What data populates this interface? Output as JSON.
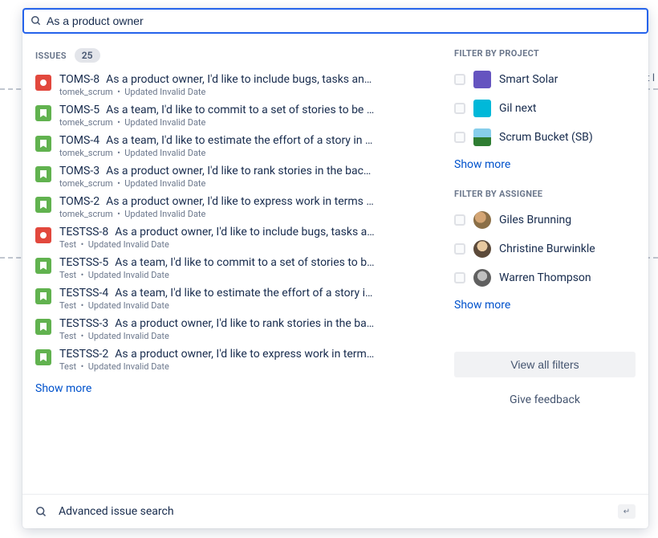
{
  "search": {
    "query": "As a product owner"
  },
  "issues": {
    "label": "ISSUES",
    "count": "25",
    "items": [
      {
        "type": "bug",
        "key": "TOMS-8",
        "summary": "As a product owner, I'd like to include bugs, tasks an…",
        "project": "tomek_scrum",
        "updated": "Updated Invalid Date"
      },
      {
        "type": "story",
        "key": "TOMS-5",
        "summary": "As a team, I'd like to commit to a set of stories to be …",
        "project": "tomek_scrum",
        "updated": "Updated Invalid Date"
      },
      {
        "type": "story",
        "key": "TOMS-4",
        "summary": "As a team, I'd like to estimate the effort of a story in …",
        "project": "tomek_scrum",
        "updated": "Updated Invalid Date"
      },
      {
        "type": "story",
        "key": "TOMS-3",
        "summary": "As a product owner, I'd like to rank stories in the bac…",
        "project": "tomek_scrum",
        "updated": "Updated Invalid Date"
      },
      {
        "type": "story",
        "key": "TOMS-2",
        "summary": "As a product owner, I'd like to express work in terms …",
        "project": "tomek_scrum",
        "updated": "Updated Invalid Date"
      },
      {
        "type": "bug",
        "key": "TESTSS-8",
        "summary": "As a product owner, I'd like to include bugs, tasks a…",
        "project": "Test",
        "updated": "Updated Invalid Date"
      },
      {
        "type": "story",
        "key": "TESTSS-5",
        "summary": "As a team, I'd like to commit to a set of stories to b…",
        "project": "Test",
        "updated": "Updated Invalid Date"
      },
      {
        "type": "story",
        "key": "TESTSS-4",
        "summary": "As a team, I'd like to estimate the effort of a story i…",
        "project": "Test",
        "updated": "Updated Invalid Date"
      },
      {
        "type": "story",
        "key": "TESTSS-3",
        "summary": "As a product owner, I'd like to rank stories in the ba…",
        "project": "Test",
        "updated": "Updated Invalid Date"
      },
      {
        "type": "story",
        "key": "TESTSS-2",
        "summary": "As a product owner, I'd like to express work in term…",
        "project": "Test",
        "updated": "Updated Invalid Date"
      }
    ],
    "show_more": "Show more"
  },
  "filters": {
    "project_label": "FILTER BY PROJECT",
    "projects": [
      {
        "name": "Smart Solar",
        "icon": "p1"
      },
      {
        "name": "Gil next",
        "icon": "p2"
      },
      {
        "name": "Scrum Bucket (SB)",
        "icon": "p3"
      }
    ],
    "project_show_more": "Show more",
    "assignee_label": "FILTER BY ASSIGNEE",
    "assignees": [
      {
        "name": "Giles Brunning",
        "avatar": "a1"
      },
      {
        "name": "Christine Burwinkle",
        "avatar": "a2"
      },
      {
        "name": "Warren Thompson",
        "avatar": "a3"
      }
    ],
    "assignee_show_more": "Show more",
    "view_all": "View all filters",
    "feedback": "Give feedback"
  },
  "footer": {
    "advanced": "Advanced issue search"
  }
}
